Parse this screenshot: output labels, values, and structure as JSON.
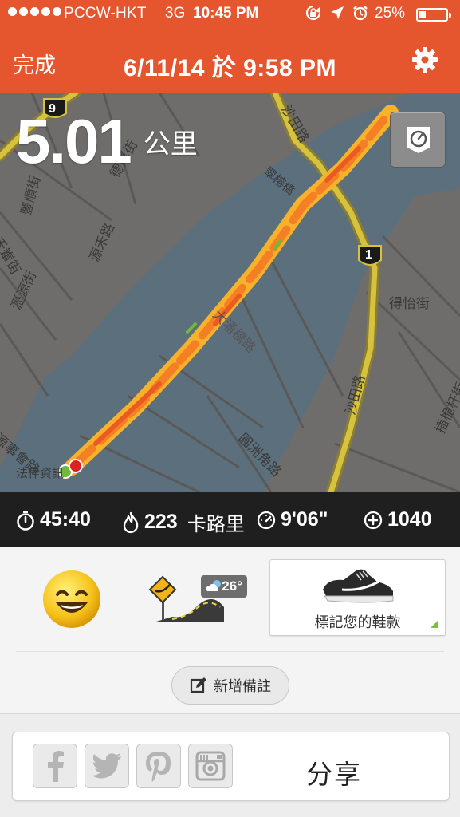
{
  "status_bar": {
    "carrier": "PCCW-HKT",
    "network": "3G",
    "time": "10:45 PM",
    "battery": "25%",
    "battery_level": 0.25,
    "icons": [
      "signal-dots-icon",
      "rotation-lock-icon",
      "location-arrow-icon",
      "alarm-clock-icon",
      "battery-icon"
    ]
  },
  "header": {
    "done_label": "完成",
    "title": "6/11/14 於 9:58 PM",
    "settings_icon": "gear-icon",
    "background": "#e5552e"
  },
  "map": {
    "distance_value": "5.01",
    "distance_unit": "公里",
    "pace_button_icon": "speedometer-icon",
    "road_badges": [
      "9",
      "1"
    ],
    "labels": [
      "沙田路",
      "翠榕橋",
      "德厚街",
      "豐順街",
      "源禾路",
      "禾輋街",
      "瀝源街",
      "得怡街",
      "沙田路",
      "插桅杆街",
      "圓洲角路",
      "大涌橋路",
      "法律資訊",
      "源事會路"
    ],
    "route_colors": [
      "#f7b12a",
      "#f57f25",
      "#ec5a23",
      "#72b83a"
    ]
  },
  "stats": {
    "duration": "45:40",
    "calories": "223",
    "calories_unit": "卡路里",
    "pace": "9'06\"",
    "fuel": "1040",
    "icons": [
      "stopwatch-icon",
      "flame-icon",
      "pace-gauge-icon",
      "nikefuel-icon"
    ]
  },
  "details": {
    "mood_icon": "happy-smiley-icon",
    "terrain_icon": "road-terrain-icon",
    "temperature": "26°",
    "weather_icon": "partly-cloudy-icon",
    "shoe_label": "標記您的鞋款",
    "add_note_label": "新增備註"
  },
  "share": {
    "label": "分享",
    "networks": [
      "facebook-icon",
      "twitter-icon",
      "pinterest-icon",
      "instagram-icon"
    ]
  }
}
